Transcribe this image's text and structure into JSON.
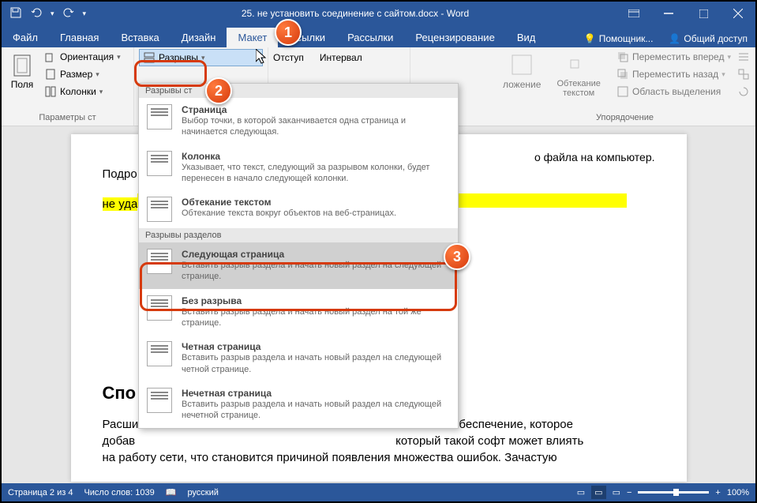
{
  "titlebar": {
    "document_title": "25. не            установить соединение с сайтом.docx - Word"
  },
  "tabs": {
    "file": "Файл",
    "home": "Главная",
    "insert": "Вставка",
    "design": "Дизайн",
    "layout": "Макет",
    "references": "Ссылки",
    "mailings": "Рассылки",
    "review": "Рецензирование",
    "view": "Вид",
    "tell_me": "Помощник...",
    "share": "Общий доступ"
  },
  "ribbon": {
    "margins": "Поля",
    "orientation": "Ориентация",
    "size": "Размер",
    "columns": "Колонки",
    "breaks": "Разрывы",
    "page_setup": "Параметры ст",
    "indent": "Отступ",
    "spacing": "Интервал",
    "position": "ложение",
    "wrap": "Обтекание текстом",
    "bring_forward": "Переместить вперед",
    "send_backward": "Переместить назад",
    "selection_pane": "Область выделения",
    "arrange": "Упорядочение"
  },
  "dropdown": {
    "section1": "Разрывы ст",
    "page_title": "Страница",
    "page_desc": "Выбор точки, в которой заканчивается одна страница и начинается следующая.",
    "column_title": "Колонка",
    "column_desc": "Указывает, что текст, следующий за разрывом колонки, будет перенесен в начало следующей колонки.",
    "textwrap_title": "Обтекание текстом",
    "textwrap_desc": "Обтекание текста вокруг объектов на веб-страницах.",
    "section2": "Разрывы разделов",
    "nextpage_title": "Следующая страница",
    "nextpage_desc": "Вставить разрыв раздела и начать новый раздел на следующей странице.",
    "continuous_title": "Без разрыва",
    "continuous_desc": "Вставить разрыв раздела и начать новый раздел на той же странице.",
    "evenpage_title": "Четная страница",
    "evenpage_desc": "Вставить разрыв раздела и начать новый раздел на следующей четной странице.",
    "oddpage_title": "Нечетная страница",
    "oddpage_desc": "Вставить разрыв раздела и начать новый раздел на следующей нечетной странице."
  },
  "document": {
    "line1": "Подро",
    "line2": "не уда",
    "heading": "Спо                                                          ний",
    "p1_a": "Расши",
    "p1_b": "имное обеспечение, которое",
    "p2_a": "добав",
    "p2_b": "который такой софт может влиять",
    "p3": "на работу сети, что становится причиной появления множества ошибок. Зачастую",
    "tail": "о файла на компьютер."
  },
  "statusbar": {
    "page": "Страница 2 из 4",
    "words": "Число слов: 1039",
    "lang": "русский",
    "zoom": "100%"
  },
  "callouts": {
    "c1": "1",
    "c2": "2",
    "c3": "3"
  }
}
